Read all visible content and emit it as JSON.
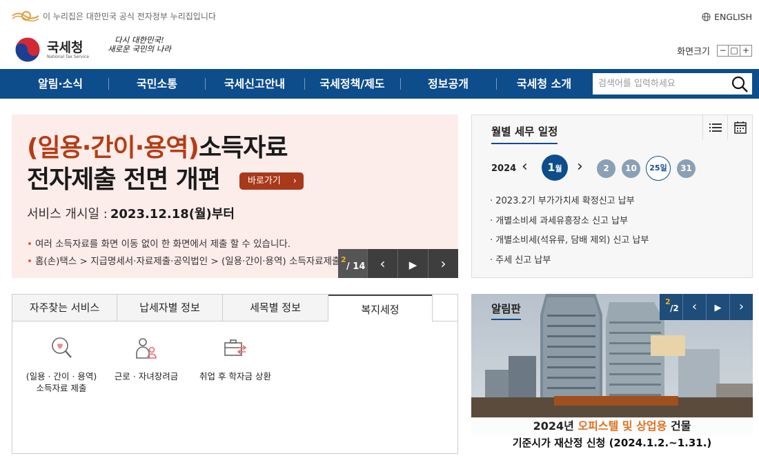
{
  "topbar": {
    "gov_notice": "이 누리집은 대한민국 공식 전자정부 누리집입니다",
    "language_link": "ENGLISH"
  },
  "header": {
    "logo_name": "국세청",
    "logo_sub": "National Tax Service",
    "slogan_line1": "다시 대한민국!",
    "slogan_line2": "새로운 국민의 나라",
    "font_size_label": "화면크기",
    "font_size_buttons": [
      "−",
      "□",
      "+"
    ]
  },
  "nav": {
    "items": [
      "알림·소식",
      "국민소통",
      "국세신고안내",
      "국세정책/제도",
      "정보공개",
      "국세청 소개"
    ],
    "search_placeholder": "검색어를 입력하세요"
  },
  "banner": {
    "title_highlight": "(일용·간이·용역)",
    "title_rest": "소득자료",
    "title_line2": "전자제출 전면 개편",
    "goto_label": "바로가기",
    "service_label": "서비스 개시일 :",
    "service_date": "2023.12.18(월)부터",
    "bullets": [
      "여러 소득자료를 화면 이동 없이 한 화면에서 제출 할 수 있습니다.",
      "홈(손)택스 > 지급명세서·자료제출·공익법인 > (일용·간이·용역) 소득자료제출"
    ],
    "pager_current": "2",
    "pager_total": "/ 14"
  },
  "calendar": {
    "title": "월별 세무 일정",
    "year": "2024",
    "month_number": "1",
    "month_suffix": "월",
    "days": [
      "2",
      "10",
      "25일",
      "31"
    ],
    "events": [
      "2023.2기 부가가치세 확정신고 납부",
      "개별소비세 과세유흥장소 신고 납부",
      "개별소비세(석유류, 담배 제외) 신고 납부",
      "주세 신고 납부"
    ]
  },
  "tabs": {
    "labels": [
      "자주찾는 서비스",
      "납세자별 정보",
      "세목별 정보",
      "복지세정"
    ],
    "services": [
      {
        "line1": "(일용 · 간이 · 용역)",
        "line2": "소득자료 제출"
      },
      {
        "line1": "근로 · 자녀장려금",
        "line2": ""
      },
      {
        "line1": "취업 후 학자금 상환",
        "line2": ""
      }
    ]
  },
  "notice": {
    "title": "알림판",
    "pager_current": "2",
    "pager_total": "/2",
    "caption_year": "2024년",
    "caption_highlight": "오피스텔 및 상업용",
    "caption_rest": "건물",
    "caption_line2": "기준시가 재산정 신청 (2024.1.2.~1.31.)"
  },
  "colors": {
    "nav_bg": "#0d4d8c",
    "banner_bg": "#fcecea",
    "banner_accent": "#b53c14",
    "goto_btn": "#a8391a"
  }
}
